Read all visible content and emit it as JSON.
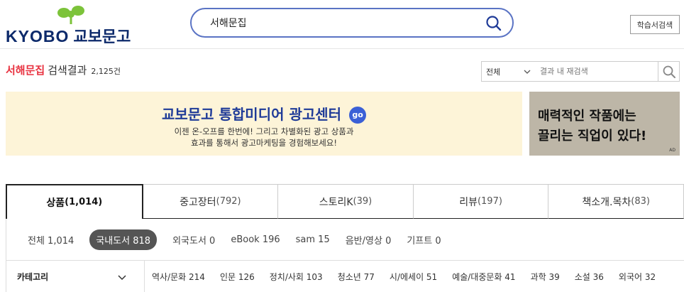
{
  "logo": {
    "text": "KYOBO",
    "text_kr": "교보문고"
  },
  "search": {
    "value": "서해문집",
    "icon": "search-icon"
  },
  "header": {
    "study_search_label": "학습서검색"
  },
  "result": {
    "keyword": "서해문집",
    "label": "검색결과",
    "count": "2,125건"
  },
  "filter": {
    "selected": "전체",
    "refine_placeholder": "결과 내 재검색"
  },
  "banner": {
    "title": "교보문고 통합미디어 광고센터",
    "go": "go",
    "line1": "이젠 온-오프를 한번에! 그리고 차별화된 광고 상품과",
    "line2": "효과를 통해서 광고마케팅을 경험해보세요!"
  },
  "ad": {
    "line1": "매력적인 작품에는",
    "line2": "끌리는 직업이 있다!",
    "mark": "AD"
  },
  "tabs": [
    {
      "label": "상품",
      "count": "(1,014)"
    },
    {
      "label": "중고장터",
      "count": "(792)"
    },
    {
      "label": "스토리K",
      "count": "(39)"
    },
    {
      "label": "리뷰",
      "count": "(197)"
    },
    {
      "label": "책소개.목차",
      "count": "(83)"
    }
  ],
  "subfilters": [
    "전체 1,014",
    "국내도서 818",
    "외국도서 0",
    "eBook 196",
    "sam 15",
    "음반/영상 0",
    "기프트 0"
  ],
  "category": {
    "label": "카테고리",
    "items": [
      "역사/문화 214",
      "인문 126",
      "정치/사회 103",
      "청소년 77",
      "시/에세이 51",
      "예술/대중문화 41",
      "과학 39",
      "소설 36",
      "외국어 32"
    ]
  },
  "colors": {
    "brand_navy": "#0d2a6b",
    "keyword_red": "#e8313f",
    "search_border": "#5a73c4",
    "leaf_green": "#7cc33a"
  }
}
